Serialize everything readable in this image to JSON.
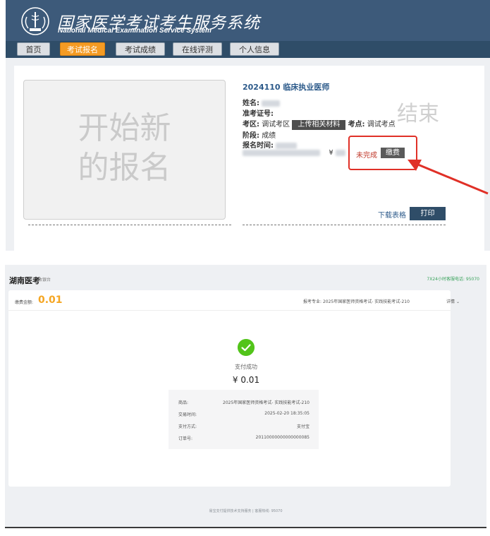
{
  "header": {
    "title": "国家医学考试考生服务系统",
    "subtitle": "National Medical Examination Service System",
    "logo_icon": "medical-exam-emblem-icon"
  },
  "nav": {
    "items": [
      {
        "label": "首页",
        "active": false
      },
      {
        "label": "考试报名",
        "active": true
      },
      {
        "label": "考试成绩",
        "active": false
      },
      {
        "label": "在线评测",
        "active": false
      },
      {
        "label": "个人信息",
        "active": false
      }
    ]
  },
  "new_registration": {
    "line1": "开始新",
    "line2": "的报名"
  },
  "registration": {
    "exam_title": "2024110 临床执业医师",
    "name_label": "姓名:",
    "ticket_label": "准考证号:",
    "region_label": "考区:",
    "region_value": "调试考区",
    "upload_button": "上传相关材料",
    "site_label": "考点:",
    "site_value": "调试考点",
    "stage_label": "阶段:",
    "stage_value": "成绩",
    "time_label": "报名时间:",
    "currency": "¥",
    "stamp": "结束",
    "status": "未完成",
    "pay_button": "缴费",
    "download_link": "下载表格",
    "print_button": "打印",
    "highlight_color": "#e03027"
  },
  "payment": {
    "brand": "湖南医考",
    "cashier": "收银台",
    "hotline": "7X24小时客服电话: 95070",
    "amount_label": "缴费金额:",
    "amount": "0.01",
    "subject_label": "报考专业:",
    "subject": "2025年国家医师资格考试- 实践技能考试-210",
    "detail_link": "详情",
    "status": "支付成功",
    "paid_amount": "¥ 0.01",
    "success_color": "#52c41a",
    "rows": [
      {
        "label": "商品:",
        "value": "2025年国家医师资格考试- 实践技能考试-210"
      },
      {
        "label": "交易时间:",
        "value": "2025-02-20 18:35:05"
      },
      {
        "label": "支付方式:",
        "value": "支付宝"
      },
      {
        "label": "订单号:",
        "value": "20110000000000000085"
      }
    ],
    "footer": "易宝支付提供技术支持服务 | 客服热线: 95070"
  }
}
